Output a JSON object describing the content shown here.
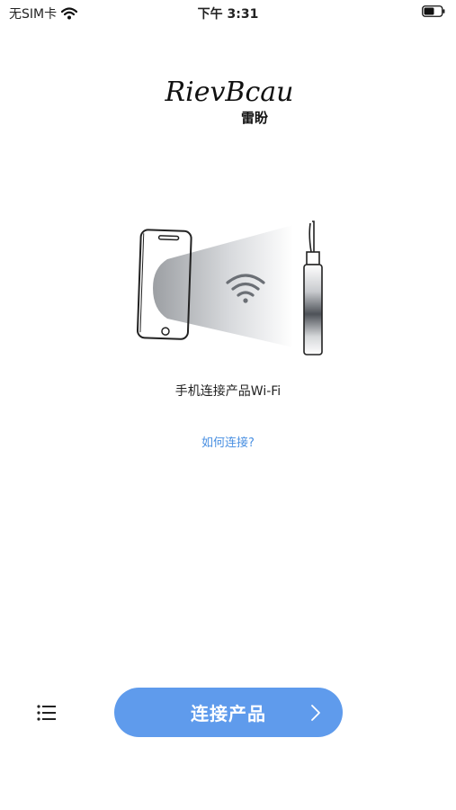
{
  "status_bar": {
    "carrier": "无SIM卡",
    "time": "下午 3:31"
  },
  "logo": {
    "brand_latin": "RievBcau",
    "brand_cn": "雷盼"
  },
  "main": {
    "caption": "手机连接产品Wi-Fi",
    "help_link": "如何连接?"
  },
  "footer": {
    "menu_icon": "list-icon",
    "connect_label": "连接产品"
  },
  "colors": {
    "accent": "#5f9bec",
    "link": "#4a90e2"
  }
}
